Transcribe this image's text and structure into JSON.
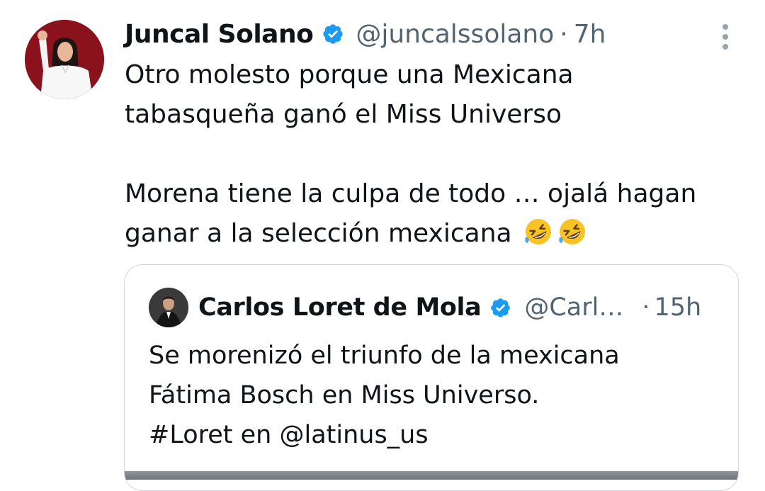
{
  "tweet": {
    "author": {
      "name": "Juncal Solano",
      "handle": "@juncalssolano",
      "verified": true
    },
    "separator": "·",
    "time": "7h",
    "text_lines": [
      "Otro molesto porque una Mexicana",
      "tabasqueña ganó el Miss Universo",
      "",
      "Morena tiene la culpa de todo … ojalá hagan",
      "ganar a la selección mexicana"
    ],
    "emojis": [
      "rofl-emoji",
      "rofl-emoji"
    ],
    "more_icon": "more-vertical-icon"
  },
  "quote": {
    "author": {
      "name": "Carlos Loret de Mola",
      "handle": "@Carl…",
      "verified": true
    },
    "separator": "·",
    "time": "15h",
    "text_lines": [
      "Se morenizó el triunfo de la mexicana",
      "Fátima Bosch en Miss Universo.",
      "#Loret en @latinus_us"
    ]
  },
  "colors": {
    "text_primary": "#0f1419",
    "text_secondary": "#536471",
    "verified_blue": "#1d9bf0",
    "border": "#cfd9de",
    "avatar_bg": "#8a121c"
  }
}
